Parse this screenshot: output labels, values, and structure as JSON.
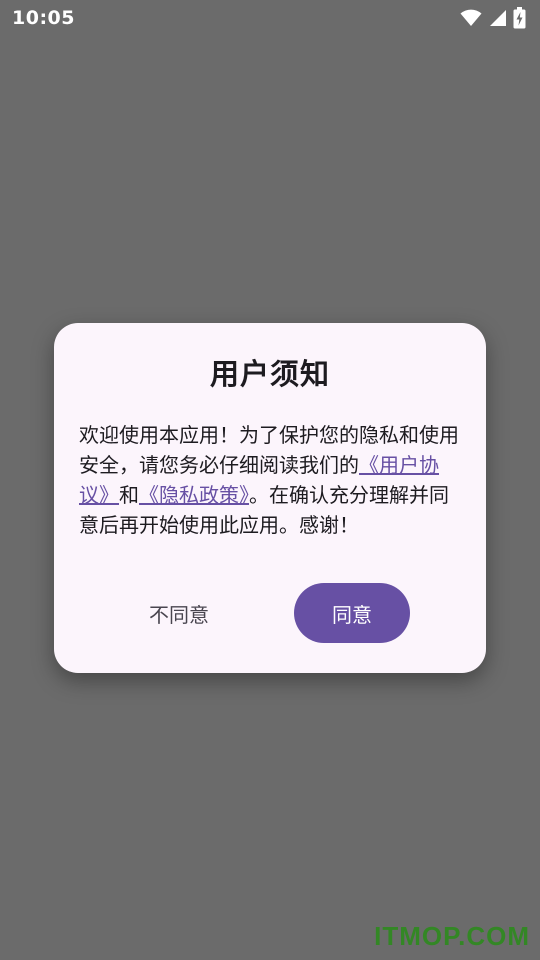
{
  "status_bar": {
    "time": "10:05",
    "icons": [
      "wifi-icon",
      "cellular-signal-icon",
      "battery-charging-icon"
    ]
  },
  "dialog": {
    "title": "用户须知",
    "body": {
      "text_1": "欢迎使用本应用！为了保护您的隐私和使用安全，请您务必仔细阅读我们的",
      "link_user_agreement": "《用户协议》",
      "text_2": "和",
      "link_privacy_policy": "《隐私政策》",
      "text_3": "。在确认充分理解并同意后再开始使用此应用。感谢！"
    },
    "disagree_label": "不同意",
    "agree_label": "同意"
  },
  "colors": {
    "overlay": "#6b6b6b",
    "dialog_bg": "#fcf5fc",
    "primary": "#6750a4",
    "watermark": "#2e8b1e"
  },
  "watermark": "ITMOP.COM"
}
